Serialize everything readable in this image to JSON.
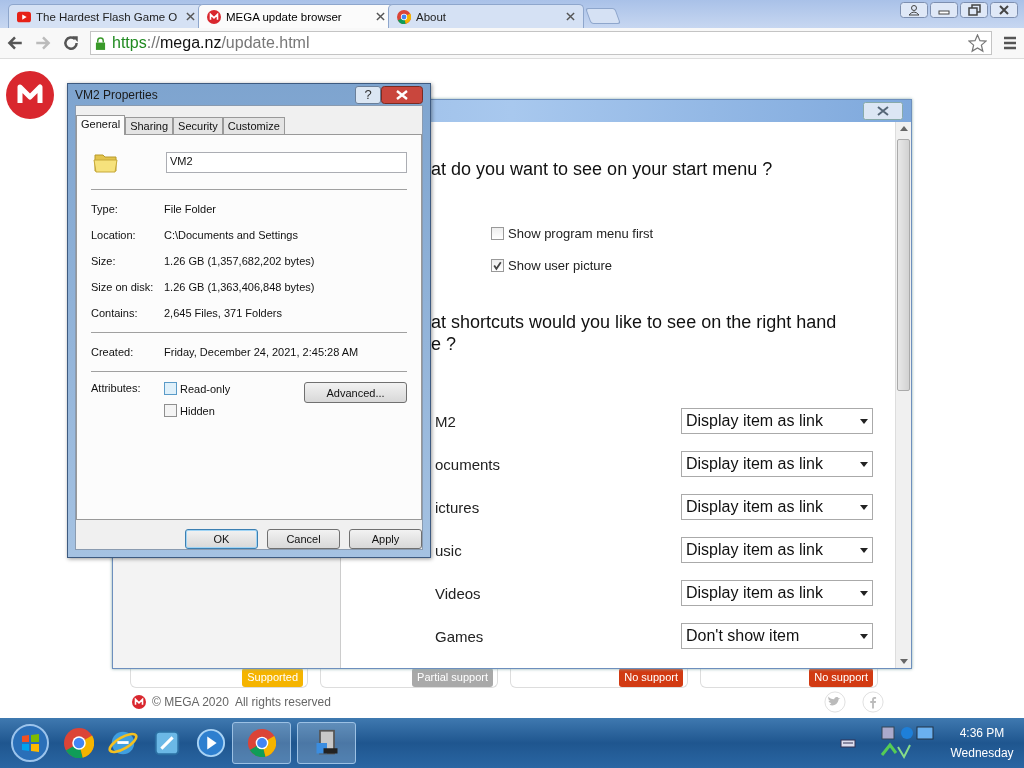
{
  "browser": {
    "tabs": [
      {
        "title": "The Hardest Flash Game O",
        "selected": false
      },
      {
        "title": "MEGA update browser",
        "selected": true
      },
      {
        "title": "About",
        "selected": false
      }
    ],
    "address": {
      "scheme": "https",
      "separator": "://",
      "host": "mega.nz",
      "path": "/update.html"
    }
  },
  "settings_window": {
    "heading_1": "at do you want to see on your start menu ?",
    "options": [
      {
        "label": "Show program menu first",
        "checked": false
      },
      {
        "label": "Show user picture",
        "checked": true
      }
    ],
    "heading_2": "at shortcuts would you like to see on the right hand",
    "heading_2_cont": "e ?",
    "shortcuts": [
      {
        "label": "M2",
        "value": "Display item as link"
      },
      {
        "label": "ocuments",
        "value": "Display item as link"
      },
      {
        "label": "ictures",
        "value": "Display item as link"
      },
      {
        "label": "usic",
        "value": "Display item as link"
      },
      {
        "label": "Videos",
        "value": "Display item as link"
      },
      {
        "label": "Games",
        "value": "Don't show item"
      }
    ]
  },
  "support_badges": [
    {
      "label": "Supported",
      "color": "#f5b400"
    },
    {
      "label": "Partial support",
      "color": "#a9a9a9"
    },
    {
      "label": "No support",
      "color": "#d23a12"
    },
    {
      "label": "No support",
      "color": "#d23a12"
    }
  ],
  "footer": {
    "copyright": "© MEGA 2020",
    "rights": "All rights reserved"
  },
  "dialog": {
    "title": "VM2 Properties",
    "help": "?",
    "tabs": [
      {
        "label": "General",
        "selected": true
      },
      {
        "label": "Sharing",
        "selected": false
      },
      {
        "label": "Security",
        "selected": false
      },
      {
        "label": "Customize",
        "selected": false
      }
    ],
    "name": "VM2",
    "group_1": [
      {
        "label": "Type:",
        "value": "File Folder"
      },
      {
        "label": "Location:",
        "value": "C:\\Documents and Settings"
      },
      {
        "label": "Size:",
        "value": "1.26 GB (1,357,682,202 bytes)"
      },
      {
        "label": "Size on disk:",
        "value": "1.26 GB (1,363,406,848 bytes)"
      },
      {
        "label": "Contains:",
        "value": "2,645 Files, 371 Folders"
      }
    ],
    "group_2": [
      {
        "label": "Created:",
        "value": "Friday, December 24, 2021, 2:45:28 AM"
      }
    ],
    "attributes_label": "Attributes:",
    "attributes": [
      {
        "label": "Read-only",
        "checked": false
      },
      {
        "label": "Hidden",
        "checked": false
      }
    ],
    "advanced_button": "Advanced...",
    "buttons": [
      "OK",
      "Cancel",
      "Apply"
    ]
  },
  "taskbar": {
    "time": "4:36 PM",
    "day": "Wednesday"
  }
}
